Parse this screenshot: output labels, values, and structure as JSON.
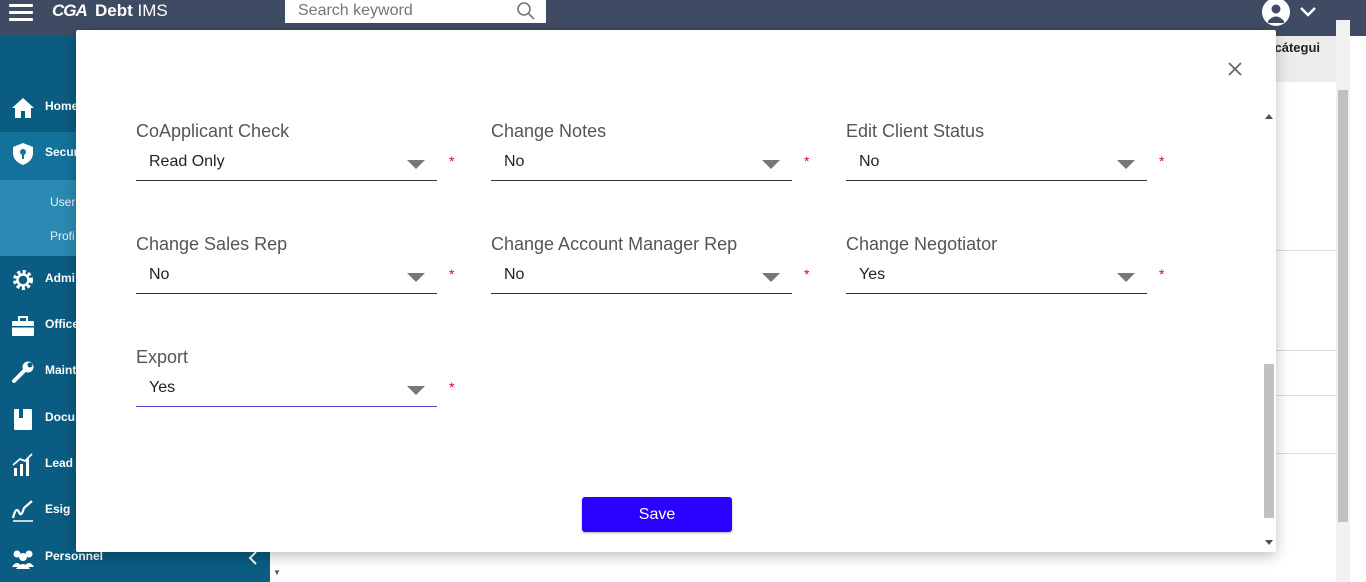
{
  "header": {
    "logo_text": "CGA",
    "app_title_bold": "Debt",
    "app_title_rest": " IMS",
    "search": {
      "placeholder": "Search keyword",
      "value": ""
    }
  },
  "sidebar": {
    "items": [
      {
        "label": "Home",
        "icon": "home-icon"
      },
      {
        "label": "Secur",
        "icon": "shield-icon",
        "active": true
      },
      {
        "label": "Admi",
        "icon": "gear-icon"
      },
      {
        "label": "Office",
        "icon": "briefcase-icon"
      },
      {
        "label": "Maint",
        "icon": "wrench-icon"
      },
      {
        "label": "Docu",
        "icon": "document-icon"
      },
      {
        "label": "Lead",
        "icon": "chart-icon"
      },
      {
        "label": "Esig",
        "icon": "signature-icon"
      },
      {
        "label": "Personnel",
        "icon": "people-icon"
      }
    ],
    "sub_items": [
      {
        "label": "User"
      },
      {
        "label": "Profi"
      }
    ]
  },
  "background": {
    "user_name": "zcátegui"
  },
  "modal": {
    "fields": [
      {
        "label": "CoApplicant Check",
        "value": "Read Only"
      },
      {
        "label": "Change Notes",
        "value": "No"
      },
      {
        "label": "Edit Client Status",
        "value": "No"
      },
      {
        "label": "Change Sales Rep",
        "value": "No"
      },
      {
        "label": "Change Account Manager Rep",
        "value": "No"
      },
      {
        "label": "Change Negotiator",
        "value": "Yes"
      },
      {
        "label": "Export",
        "value": "Yes"
      }
    ],
    "required_mark": "*",
    "save_label": "Save"
  },
  "colors": {
    "topbar": "#3f4b63",
    "sidebar": "#0b5c82",
    "sidebar_active": "#13729c",
    "sidebar_sub": "#2b8ab3",
    "save_button": "#2a00ff",
    "required": "#e0003a",
    "focus_underline": "#5b3bd6"
  }
}
